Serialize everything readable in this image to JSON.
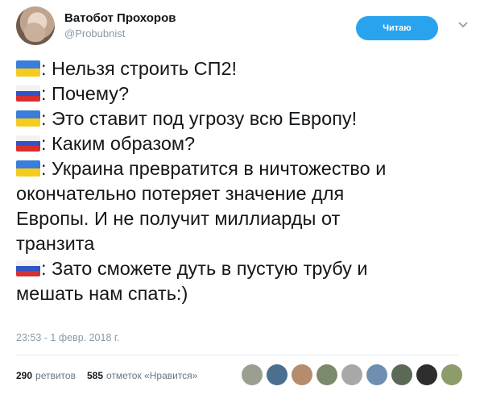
{
  "tweet": {
    "author": {
      "display_name": "Ватобот Прохоров",
      "handle": "@Probubnist"
    },
    "follow_label": "Читаю",
    "lines": [
      {
        "flag": "ua",
        "text": ": Нельзя строить СП2!"
      },
      {
        "flag": "ru",
        "text": ": Почему?"
      },
      {
        "flag": "ua",
        "text": ": Это ставит под угрозу всю Европу!"
      },
      {
        "flag": "ru",
        "text": ": Каким образом?"
      },
      {
        "flag": "ua",
        "text": ": Украина превратится в ничтожество и"
      },
      {
        "flag": "",
        "text": "окончательно потеряет значение для"
      },
      {
        "flag": "",
        "text": "Европы. И не получит миллиарды от"
      },
      {
        "flag": "",
        "text": "транзита"
      },
      {
        "flag": "ru",
        "text": ": Зато сможете дуть в пустую трубу и"
      },
      {
        "flag": "",
        "text": "мешать нам спать:)"
      }
    ],
    "timestamp": "23:53 - 1 февр. 2018 г.",
    "stats": {
      "retweets_count": "290",
      "retweets_label": "ретвитов",
      "likes_count": "585",
      "likes_label": "отметок «Нравится»"
    },
    "likers": [
      {
        "icon": "avatar-1",
        "color": "#9aa08f"
      },
      {
        "icon": "avatar-2",
        "color": "#4b6f8f"
      },
      {
        "icon": "avatar-3",
        "color": "#b58d6c"
      },
      {
        "icon": "avatar-4",
        "color": "#7a8a6b"
      },
      {
        "icon": "avatar-5",
        "color": "#a8a8a8"
      },
      {
        "icon": "avatar-6",
        "color": "#6e8fb0"
      },
      {
        "icon": "avatar-7",
        "color": "#5a6a56"
      },
      {
        "icon": "avatar-8",
        "color": "#2e2e2e"
      },
      {
        "icon": "avatar-9",
        "color": "#8c9c6a"
      }
    ]
  }
}
